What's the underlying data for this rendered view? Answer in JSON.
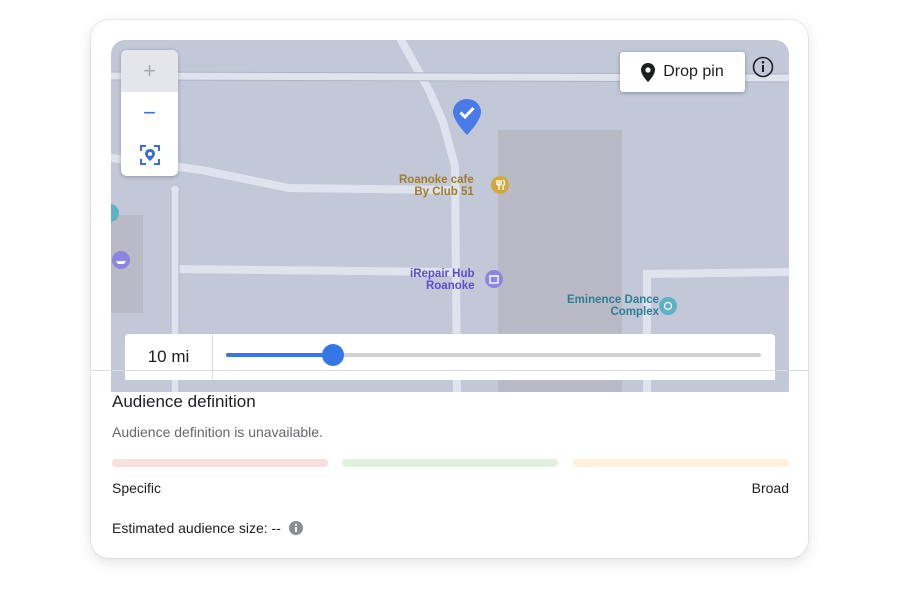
{
  "map": {
    "zoom_in_label": "+",
    "zoom_out_label": "−",
    "drop_pin_label": "Drop pin",
    "pois": [
      {
        "line1": "Roanoke cafe",
        "line2": "By Club 51",
        "color": "#a07d2c",
        "icon_color": "#d3a93c",
        "icon": "restaurant-icon"
      },
      {
        "line1": "iRepair Hub",
        "line2": "Roanoke",
        "color": "#5b4fc9",
        "icon_color": "#8d86e0",
        "icon": "shop-icon"
      },
      {
        "line1": "Eminence Dance",
        "line2": "Complex",
        "color": "#2f7e93",
        "icon_color": "#5fb2c6",
        "icon": "fitness-icon"
      }
    ]
  },
  "radius": {
    "value_label": "10 mi",
    "slider_fraction": 0.2
  },
  "audience": {
    "title": "Audience definition",
    "subtitle": "Audience definition is unavailable.",
    "specific_label": "Specific",
    "broad_label": "Broad",
    "estimated_label": "Estimated audience size: --",
    "meter_colors": [
      "#f7dfe2",
      "#e2f0e2",
      "#fbf1dd"
    ]
  },
  "colors": {
    "accent": "#3578e5",
    "map_bg": "#c3c8d9"
  }
}
